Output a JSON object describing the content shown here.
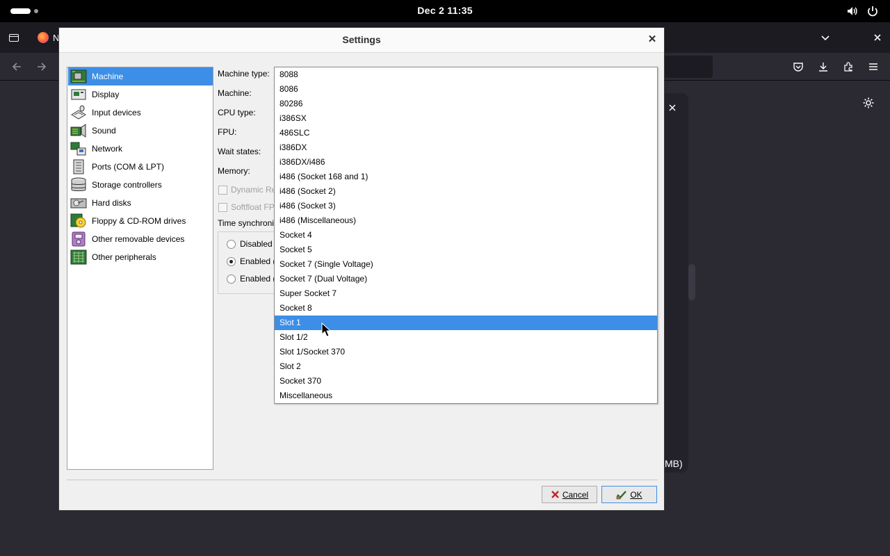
{
  "topbar": {
    "clock": "Dec 2  11:35",
    "icons": [
      "activities-pill",
      "volume-icon",
      "power-icon"
    ]
  },
  "browser": {
    "tab_title_fragment": "N",
    "right_panel_text": "MB)"
  },
  "dialog": {
    "title": "Settings",
    "sidebar": {
      "items": [
        {
          "label": "Machine",
          "icon": "machine-icon",
          "selected": true
        },
        {
          "label": "Display",
          "icon": "display-icon"
        },
        {
          "label": "Input devices",
          "icon": "input-devices-icon"
        },
        {
          "label": "Sound",
          "icon": "sound-icon"
        },
        {
          "label": "Network",
          "icon": "network-icon"
        },
        {
          "label": "Ports (COM & LPT)",
          "icon": "ports-icon"
        },
        {
          "label": "Storage controllers",
          "icon": "storage-controllers-icon"
        },
        {
          "label": "Hard disks",
          "icon": "hard-disk-icon"
        },
        {
          "label": "Floppy & CD-ROM drives",
          "icon": "floppy-cdrom-icon"
        },
        {
          "label": "Other removable devices",
          "icon": "removable-device-icon"
        },
        {
          "label": "Other peripherals",
          "icon": "peripherals-icon"
        }
      ]
    },
    "machine": {
      "machine_type_label": "Machine type:",
      "machine_label": "Machine:",
      "cpu_type_label": "CPU type:",
      "fpu_label": "FPU:",
      "wait_states_label": "Wait states:",
      "memory_label": "Memory:",
      "dynamic_recompiler_label": "Dynamic Re",
      "softfloat_label": "Softfloat FP",
      "time_sync_label": "Time synchroni",
      "time_sync_options": [
        {
          "label": "Disabled",
          "checked": false
        },
        {
          "label": "Enabled (",
          "checked": true
        },
        {
          "label": "Enabled (",
          "checked": false
        }
      ]
    },
    "machine_type_dropdown": {
      "options": [
        "8088",
        "8086",
        "80286",
        "i386SX",
        "486SLC",
        "i386DX",
        "i386DX/i486",
        "i486 (Socket 168 and 1)",
        "i486 (Socket 2)",
        "i486 (Socket 3)",
        "i486 (Miscellaneous)",
        "Socket 4",
        "Socket 5",
        "Socket 7 (Single Voltage)",
        "Socket 7 (Dual Voltage)",
        "Super Socket 7",
        "Socket 8",
        "Slot 1",
        "Slot 1/2",
        "Slot 1/Socket 370",
        "Slot 2",
        "Socket 370",
        "Miscellaneous"
      ],
      "highlighted": "Slot 1"
    },
    "buttons": {
      "cancel": "Cancel",
      "ok": "OK"
    }
  }
}
